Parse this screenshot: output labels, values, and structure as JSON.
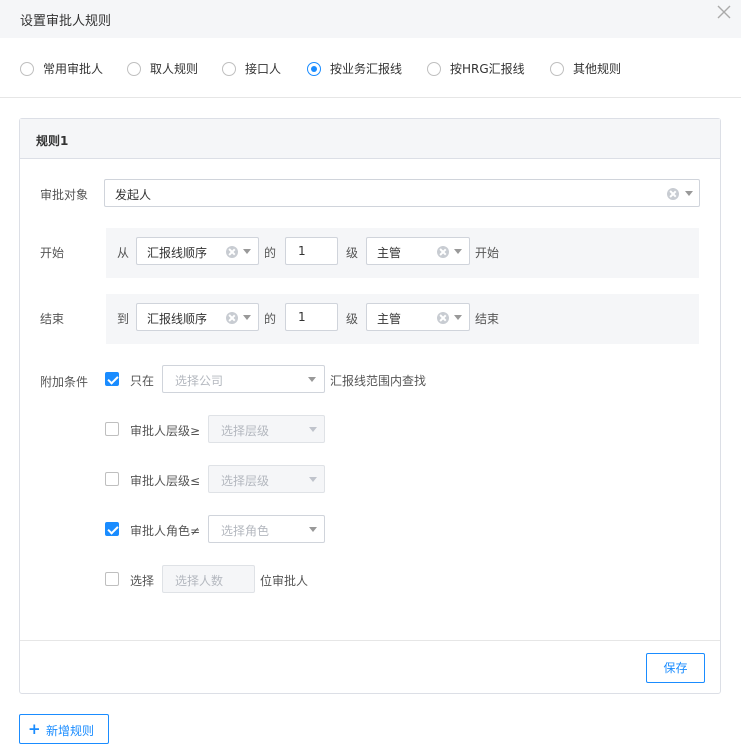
{
  "dialog": {
    "title": "设置审批人规则"
  },
  "tabs": [
    {
      "label": "常用审批人",
      "selected": false
    },
    {
      "label": "取人规则",
      "selected": false
    },
    {
      "label": "接口人",
      "selected": false
    },
    {
      "label": "按业务汇报线",
      "selected": true
    },
    {
      "label": "按HRG汇报线",
      "selected": false
    },
    {
      "label": "其他规则",
      "selected": false
    }
  ],
  "rule": {
    "title": "规则1",
    "target": {
      "label": "审批对象",
      "value": "发起人"
    },
    "start": {
      "label": "开始",
      "prefix": "从",
      "line": "汇报线顺序",
      "of": "的",
      "level_value": "1",
      "level": "级",
      "role": "主管",
      "suffix": "开始"
    },
    "end": {
      "label": "结束",
      "prefix": "到",
      "line": "汇报线顺序",
      "of": "的",
      "level_value": "1",
      "level": "级",
      "role": "主管",
      "suffix": "结束"
    },
    "conditions": {
      "label": "附加条件",
      "only": {
        "checked": true,
        "label": "只在",
        "placeholder": "选择公司",
        "suffix": "汇报线范围内查找"
      },
      "level_ge": {
        "checked": false,
        "label": "审批人层级≥",
        "placeholder": "选择层级"
      },
      "level_le": {
        "checked": false,
        "label": "审批人层级≤",
        "placeholder": "选择层级"
      },
      "role_ne": {
        "checked": true,
        "label": "审批人角色≠",
        "placeholder": "选择角色"
      },
      "choose": {
        "checked": false,
        "label": "选择",
        "placeholder": "选择人数",
        "suffix": "位审批人"
      }
    },
    "save_label": "保存"
  },
  "add_rule_label": "新增规则",
  "colors": {
    "accent": "#1a8cff",
    "header_bg": "#f5f6f8"
  }
}
